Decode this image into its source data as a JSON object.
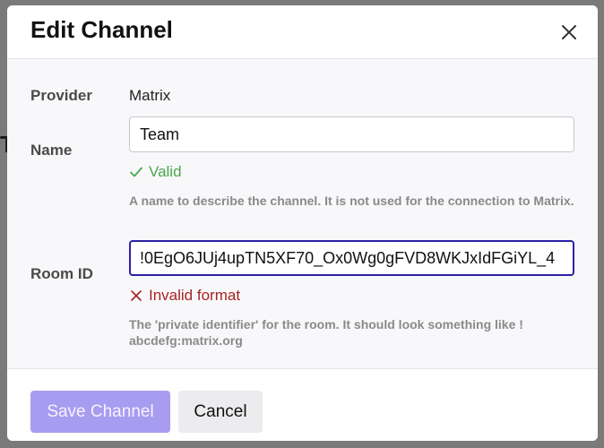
{
  "modal": {
    "title": "Edit Channel",
    "close_icon": "close-icon"
  },
  "fields": {
    "provider": {
      "label": "Provider",
      "value": "Matrix"
    },
    "name": {
      "label": "Name",
      "value": "Team",
      "status_icon": "check-icon",
      "status": "Valid",
      "status_color": "#4ca64c",
      "help": "A name to describe the channel. It is not used for the connection to Matrix."
    },
    "room_id": {
      "label": "Room ID",
      "value": "!0EgO6JUj4upTN5XF70_Ox0Wg0gFVD8WKJxIdFGiYL_4",
      "status_icon": "x-icon",
      "status": "Invalid format",
      "status_color": "#a82222",
      "help_line1": "The 'private identifier' for the room. It should look something like !",
      "help_line2": "abcdefg:matrix.org"
    }
  },
  "footer": {
    "save_label": "Save Channel",
    "cancel_label": "Cancel"
  },
  "colors": {
    "primary_button": "#a89cf0",
    "focus_border": "#2c20a6"
  }
}
